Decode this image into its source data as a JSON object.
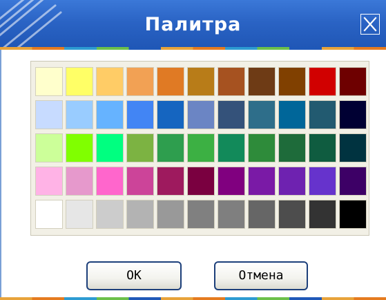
{
  "window": {
    "title": "Палитра",
    "close_icon": "close-icon"
  },
  "palette": {
    "rows": [
      [
        "#ffffcc",
        "#ffff66",
        "#ffcc66",
        "#f2a154",
        "#e07a24",
        "#b87c18",
        "#a65220",
        "#6e3b15",
        "#804000",
        "#d10000",
        "#6e0000"
      ],
      [
        "#c7dbff",
        "#99ccff",
        "#66b3ff",
        "#4285f4",
        "#1565c0",
        "#6b85c4",
        "#34527a",
        "#2e6e8a",
        "#006699",
        "#225a70",
        "#000033"
      ],
      [
        "#ccff99",
        "#80ff00",
        "#00ff80",
        "#7cb342",
        "#2e9e4e",
        "#3cb043",
        "#128a5a",
        "#2e8b3a",
        "#1e6b3a",
        "#0f5c40",
        "#003340"
      ],
      [
        "#ffb3e6",
        "#e699cc",
        "#ff66cc",
        "#cc4499",
        "#9e1a5e",
        "#7a0040",
        "#80007f",
        "#7a1aa6",
        "#6e22b0",
        "#6633cc",
        "#3d0066"
      ],
      [
        "#ffffff",
        "#e6e6e6",
        "#cccccc",
        "#b3b3b3",
        "#999999",
        "#808080",
        "#7f7f7f",
        "#666666",
        "#4d4d4d",
        "#333333",
        "#000000"
      ]
    ]
  },
  "buttons": {
    "ok_label": "OK",
    "cancel_label": "Отмена"
  },
  "colors": {
    "title_bar": "#2a63c4",
    "button_border": "#1c3f7a",
    "strip": [
      "#e8a33a",
      "#e57b1f",
      "#2d9bd2",
      "#6cc04a",
      "#1f58b8"
    ]
  }
}
